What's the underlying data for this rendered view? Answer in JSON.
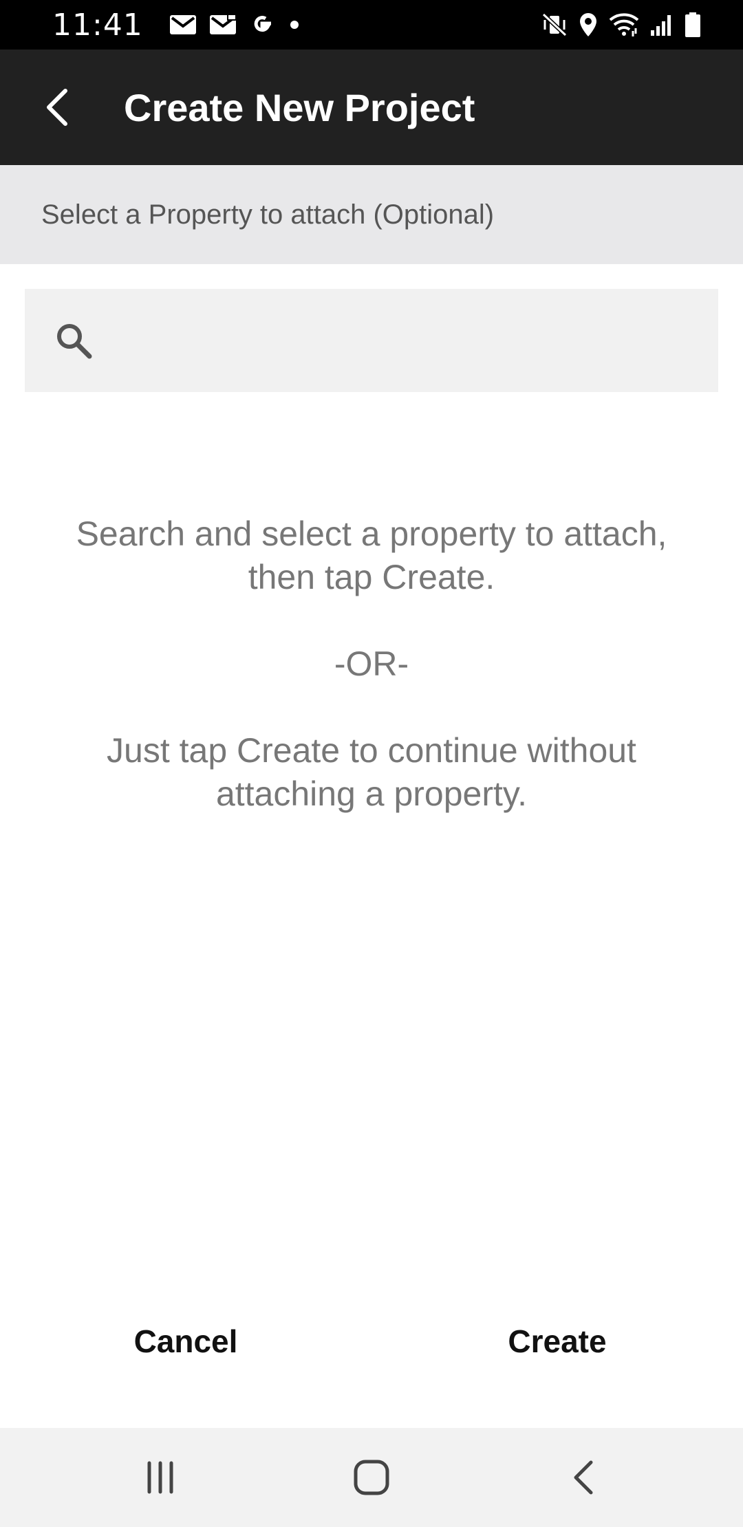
{
  "status_bar": {
    "time": "11:41",
    "left_icons": [
      "gmail-icon",
      "mail-icon",
      "google-icon",
      "notification-dot-icon"
    ],
    "right_icons": [
      "mute-vibrate-icon",
      "location-icon",
      "wifi-icon",
      "signal-icon",
      "battery-icon"
    ]
  },
  "app_bar": {
    "title": "Create New Project",
    "back_icon": "back-arrow-icon",
    "background": "#212121"
  },
  "section_header": {
    "text": "Select a Property to attach (Optional)"
  },
  "search": {
    "icon": "search-icon",
    "value": "",
    "placeholder": ""
  },
  "instructions": {
    "line1": "Search and select a property to attach,",
    "line2": "then tap Create.",
    "separator": "-OR-",
    "line3": "Just tap Create to continue without",
    "line4": "attaching a property."
  },
  "actions": {
    "cancel_label": "Cancel",
    "create_label": "Create"
  },
  "nav_bar": {
    "icons": [
      "recent-apps-icon",
      "home-icon",
      "back-icon"
    ]
  }
}
